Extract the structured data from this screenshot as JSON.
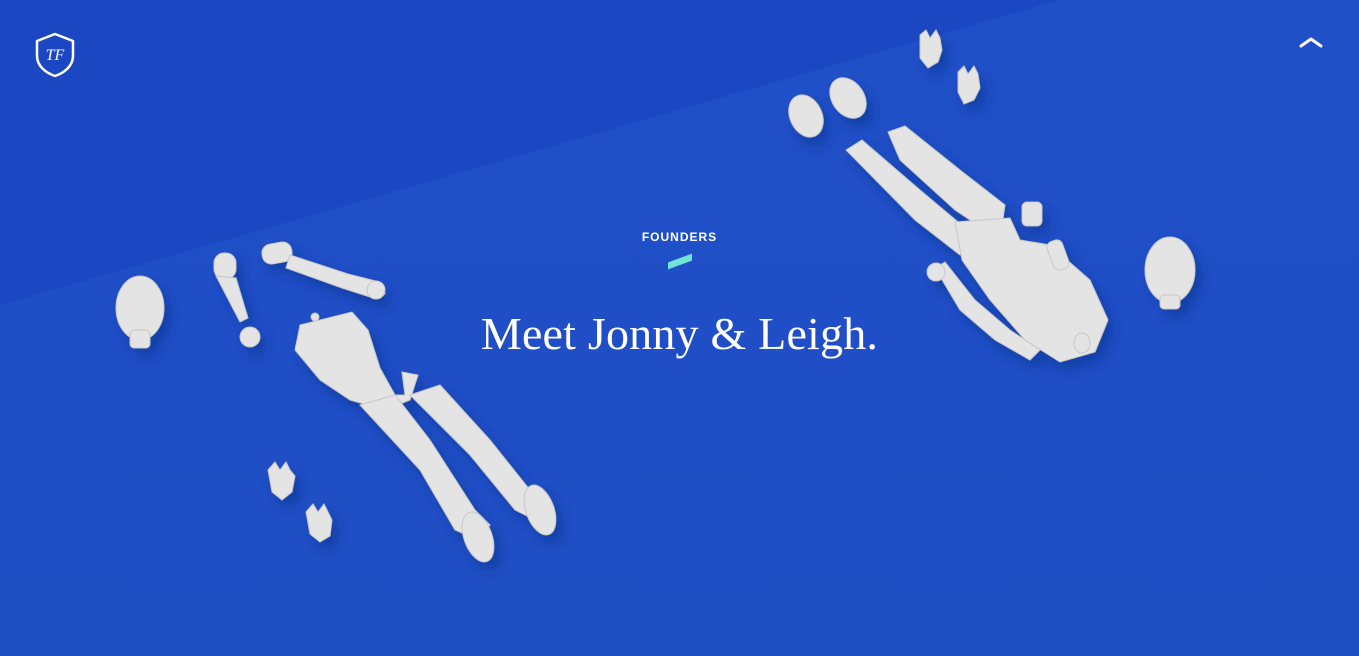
{
  "brand": {
    "logo_text": "TF",
    "logo_name": "shield-logo"
  },
  "nav": {
    "scroll_up_icon": "chevron-up-icon"
  },
  "hero": {
    "eyebrow": "FOUNDERS",
    "headline": "Meet Jonny & Leigh."
  },
  "colors": {
    "background": "#1f4ec6",
    "background_dark": "#1a47c0",
    "accent": "#6fe3d5",
    "figure": "#e6e6e6"
  }
}
